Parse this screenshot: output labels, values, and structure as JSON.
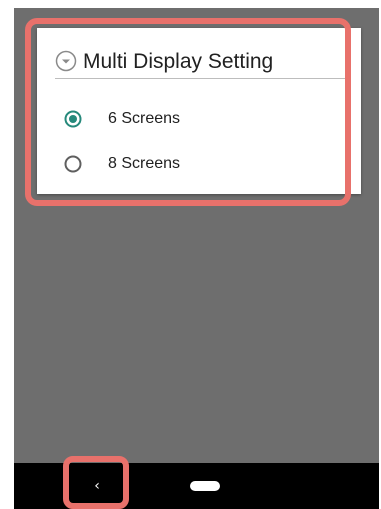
{
  "dialog": {
    "title": "Multi Display Setting",
    "options": [
      {
        "label": "6 Screens",
        "selected": true
      },
      {
        "label": "8 Screens",
        "selected": false
      }
    ]
  },
  "icons": {
    "header": "chevron-down-circle-icon",
    "back": "back-arrow-icon",
    "home": "home-pill-icon"
  },
  "nav": {
    "back_glyph": "‹"
  },
  "colors": {
    "radio_selected": "#26897b",
    "radio_unselected": "#5f5f5f",
    "highlight": "#e8716b",
    "backdrop": "#6e6e6e",
    "nav_bar": "#000000"
  }
}
